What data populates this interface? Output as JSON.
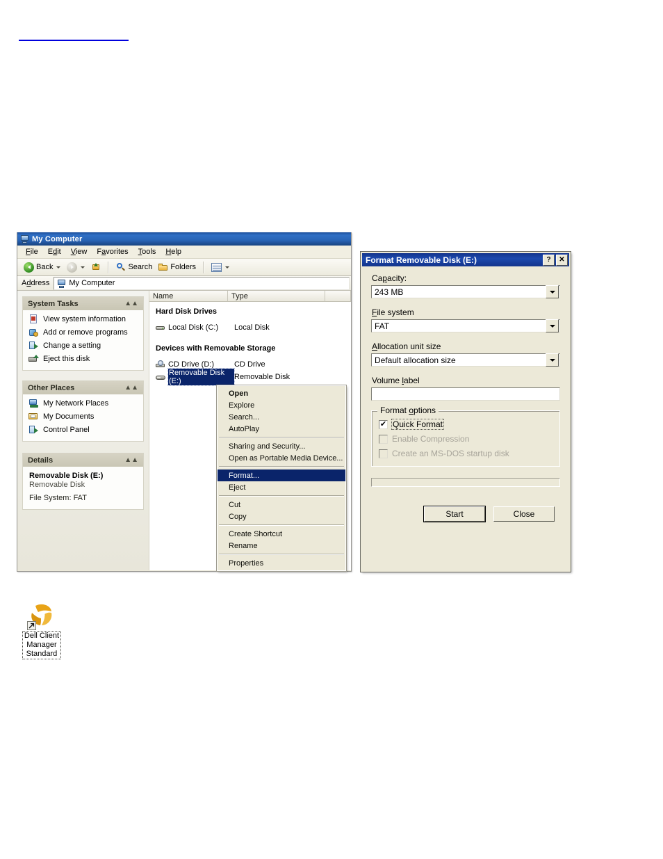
{
  "page": {
    "background": "#ffffff",
    "top_link_color": "#0000dd"
  },
  "explorer": {
    "title": "My Computer",
    "menu": [
      "File",
      "Edit",
      "View",
      "Favorites",
      "Tools",
      "Help"
    ],
    "toolbar": {
      "back_label": "Back",
      "search_label": "Search",
      "folders_label": "Folders"
    },
    "address": {
      "label": "Address",
      "value": "My Computer"
    },
    "task_panels": [
      {
        "title": "System Tasks",
        "collapse_glyph": "»",
        "items": [
          {
            "label": "View system information",
            "icon": "system-info-icon"
          },
          {
            "label": "Add or remove programs",
            "icon": "add-remove-programs-icon"
          },
          {
            "label": "Change a setting",
            "icon": "change-setting-icon"
          },
          {
            "label": "Eject this disk",
            "icon": "eject-disk-icon"
          }
        ]
      },
      {
        "title": "Other Places",
        "collapse_glyph": "»",
        "items": [
          {
            "label": "My Network Places",
            "icon": "network-places-icon"
          },
          {
            "label": "My Documents",
            "icon": "my-documents-icon"
          },
          {
            "label": "Control Panel",
            "icon": "control-panel-icon"
          }
        ]
      }
    ],
    "details": {
      "title": "Details",
      "collapse_glyph": "»",
      "name": "Removable Disk (E:)",
      "type": "Removable Disk",
      "file_system": "File System: FAT"
    },
    "columns": [
      "Name",
      "Type"
    ],
    "groups": [
      {
        "header": "Hard Disk Drives",
        "rows": [
          {
            "name": "Local Disk (C:)",
            "type": "Local Disk",
            "icon": "hard-disk-icon",
            "selected": false
          }
        ]
      },
      {
        "header": "Devices with Removable Storage",
        "rows": [
          {
            "name": "CD Drive (D:)",
            "type": "CD Drive",
            "icon": "cd-drive-icon",
            "selected": false
          },
          {
            "name": "Removable Disk (E:)",
            "type": "Removable Disk",
            "icon": "removable-disk-icon",
            "selected": true
          }
        ]
      }
    ]
  },
  "context_menu": {
    "selected_item": "Format...",
    "groups": [
      [
        {
          "label": "Open",
          "bold": true
        },
        {
          "label": "Explore",
          "bold": false
        },
        {
          "label": "Search...",
          "bold": false
        },
        {
          "label": "AutoPlay",
          "bold": false
        }
      ],
      [
        {
          "label": "Sharing and Security...",
          "bold": false
        },
        {
          "label": "Open as Portable Media Device...",
          "bold": false
        }
      ],
      [
        {
          "label": "Format...",
          "bold": false
        },
        {
          "label": "Eject",
          "bold": false
        }
      ],
      [
        {
          "label": "Cut",
          "bold": false
        },
        {
          "label": "Copy",
          "bold": false
        }
      ],
      [
        {
          "label": "Create Shortcut",
          "bold": false
        },
        {
          "label": "Rename",
          "bold": false
        }
      ],
      [
        {
          "label": "Properties",
          "bold": false
        }
      ]
    ]
  },
  "format_dialog": {
    "title": "Format Removable Disk (E:)",
    "help_button": "?",
    "close_button": "✕",
    "fields": [
      {
        "label": "Capacity:",
        "value": "243 MB"
      },
      {
        "label": "File system",
        "value": "FAT"
      },
      {
        "label": "Allocation unit size",
        "value": "Default allocation size"
      }
    ],
    "volume_label": {
      "label": "Volume label",
      "value": ""
    },
    "format_options": {
      "legend": "Format options",
      "items": [
        {
          "label": "Quick Format",
          "checked": true,
          "enabled": true,
          "focused": true
        },
        {
          "label": "Enable Compression",
          "checked": false,
          "enabled": false,
          "focused": false
        },
        {
          "label": "Create an MS-DOS startup disk",
          "checked": false,
          "enabled": false,
          "focused": false
        }
      ]
    },
    "buttons": {
      "start": "Start",
      "close": "Close"
    },
    "progress_value": 0
  },
  "desktop_shortcut": {
    "label": "Dell Client Manager Standard",
    "label_lines": [
      "Dell Client",
      "Manager",
      "Standard"
    ],
    "icon": "dell-client-manager-icon",
    "logo_color": "#e8a317"
  }
}
